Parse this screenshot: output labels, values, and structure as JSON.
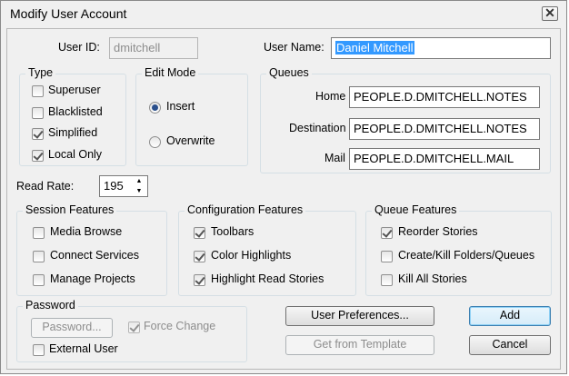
{
  "window": {
    "title": "Modify User Account",
    "close_symbol": "✕"
  },
  "user_id": {
    "label": "User ID:",
    "value": "dmitchell"
  },
  "user_name": {
    "label": "User Name:",
    "value": "Daniel Mitchell"
  },
  "type": {
    "legend": "Type",
    "items": [
      {
        "label": "Superuser",
        "checked": false
      },
      {
        "label": "Blacklisted",
        "checked": false
      },
      {
        "label": "Simplified",
        "checked": true
      },
      {
        "label": "Local Only",
        "checked": true
      }
    ]
  },
  "edit_mode": {
    "legend": "Edit Mode",
    "options": [
      {
        "label": "Insert",
        "selected": true
      },
      {
        "label": "Overwrite",
        "selected": false
      }
    ]
  },
  "queues": {
    "legend": "Queues",
    "home": {
      "label": "Home",
      "value": "PEOPLE.D.DMITCHELL.NOTES"
    },
    "destination": {
      "label": "Destination",
      "value": "PEOPLE.D.DMITCHELL.NOTES"
    },
    "mail": {
      "label": "Mail",
      "value": "PEOPLE.D.DMITCHELL.MAIL"
    }
  },
  "read_rate": {
    "label": "Read Rate:",
    "value": "195",
    "up": "▲",
    "down": "▼"
  },
  "session_features": {
    "legend": "Session Features",
    "items": [
      {
        "label": "Media Browse",
        "checked": false
      },
      {
        "label": "Connect Services",
        "checked": false
      },
      {
        "label": "Manage Projects",
        "checked": false
      }
    ]
  },
  "configuration_features": {
    "legend": "Configuration Features",
    "items": [
      {
        "label": "Toolbars",
        "checked": true
      },
      {
        "label": "Color Highlights",
        "checked": true
      },
      {
        "label": "Highlight Read Stories",
        "checked": true
      }
    ]
  },
  "queue_features": {
    "legend": "Queue Features",
    "items": [
      {
        "label": "Reorder Stories",
        "checked": true
      },
      {
        "label": "Create/Kill Folders/Queues",
        "checked": false
      },
      {
        "label": "Kill All Stories",
        "checked": false
      }
    ]
  },
  "password": {
    "legend": "Password",
    "button": "Password...",
    "force_change": {
      "label": "Force Change",
      "checked": true
    },
    "external_user": {
      "label": "External User",
      "checked": false
    }
  },
  "buttons": {
    "user_preferences": "User Preferences...",
    "get_from_template": "Get from Template",
    "add": "Add",
    "cancel": "Cancel"
  }
}
